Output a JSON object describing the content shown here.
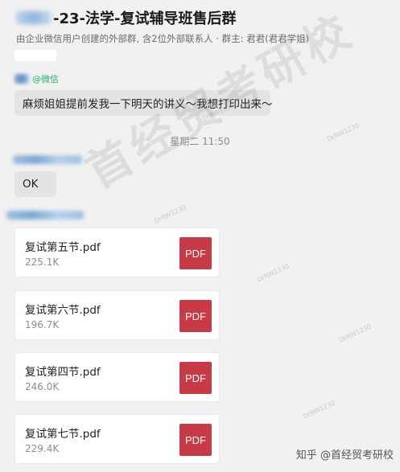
{
  "header": {
    "title": "-23-法学-复试辅导班售后群",
    "subtitle": "由企业微信用户创建的外部群, 含2位外部联系人 · 群主: 君君(君君学姐)"
  },
  "messages": {
    "first_sender_tag": "@微信",
    "first_text": "麻烦姐姐提前发我一下明天的讲义～我想打印出来～",
    "timestamp": "星期二 11:50",
    "second_text": "OK"
  },
  "files": [
    {
      "name": "复试第五节.pdf",
      "size": "225.1K",
      "icon_label": "PDF"
    },
    {
      "name": "复试第六节.pdf",
      "size": "196.7K",
      "icon_label": "PDF"
    },
    {
      "name": "复试第四节.pdf",
      "size": "246.0K",
      "icon_label": "PDF"
    },
    {
      "name": "复试第七节.pdf",
      "size": "229.4K",
      "icon_label": "PDF"
    }
  ],
  "watermark": {
    "text": "首经贸考研校",
    "tiny": [
      "DrRW1230",
      "DrRW1230",
      "DrRW1230",
      "DrRW1230",
      "DrRW1230",
      "DrRW1230"
    ]
  },
  "footer": {
    "credit": "知乎 @首经贸考研校"
  },
  "colors": {
    "background": "#f1f1f1",
    "bubble": "#e3e3e3",
    "pdf_red": "#c83a45",
    "wechat_green": "#2aae67"
  }
}
